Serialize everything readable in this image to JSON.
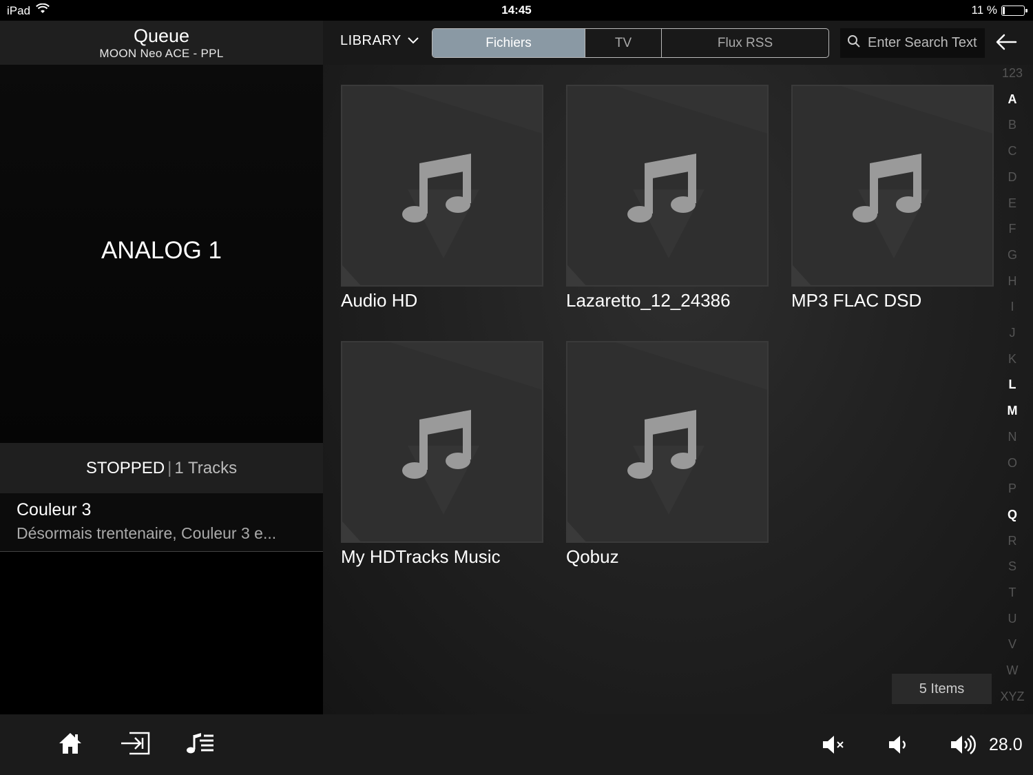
{
  "status_bar": {
    "device": "iPad",
    "time": "14:45",
    "battery": "11 %",
    "battery_level": 0.11
  },
  "queue": {
    "title": "Queue",
    "zone": "MOON Neo ACE - PPL",
    "now_playing_source": "ANALOG 1",
    "state": "STOPPED",
    "separator": "|",
    "track_count": "1 Tracks",
    "items": [
      {
        "title": "Couleur 3",
        "subtitle": "Désormais trentenaire, Couleur 3 e..."
      }
    ]
  },
  "library": {
    "dropdown_label": "LIBRARY",
    "tabs": [
      {
        "label": "Fichiers",
        "active": true
      },
      {
        "label": "TV",
        "active": false
      },
      {
        "label": "Flux RSS",
        "active": false
      }
    ],
    "search_placeholder": "Enter Search Text",
    "tiles": [
      {
        "label": "Audio HD"
      },
      {
        "label": "Lazaretto_12_24386"
      },
      {
        "label": "MP3 FLAC DSD"
      },
      {
        "label": "My HDTracks Music"
      },
      {
        "label": "Qobuz"
      }
    ],
    "items_count": "5 Items",
    "alpha_index": [
      {
        "label": "123",
        "active": false
      },
      {
        "label": "A",
        "active": true
      },
      {
        "label": "B",
        "active": false
      },
      {
        "label": "C",
        "active": false
      },
      {
        "label": "D",
        "active": false
      },
      {
        "label": "E",
        "active": false
      },
      {
        "label": "F",
        "active": false
      },
      {
        "label": "G",
        "active": false
      },
      {
        "label": "H",
        "active": false
      },
      {
        "label": "I",
        "active": false
      },
      {
        "label": "J",
        "active": false
      },
      {
        "label": "K",
        "active": false
      },
      {
        "label": "L",
        "active": true
      },
      {
        "label": "M",
        "active": true
      },
      {
        "label": "N",
        "active": false
      },
      {
        "label": "O",
        "active": false
      },
      {
        "label": "P",
        "active": false
      },
      {
        "label": "Q",
        "active": true
      },
      {
        "label": "R",
        "active": false
      },
      {
        "label": "S",
        "active": false
      },
      {
        "label": "T",
        "active": false
      },
      {
        "label": "U",
        "active": false
      },
      {
        "label": "V",
        "active": false
      },
      {
        "label": "W",
        "active": false
      },
      {
        "label": "XYZ",
        "active": false
      }
    ]
  },
  "bottom_bar": {
    "icons": [
      "home-icon",
      "input-select-icon",
      "playlist-icon",
      "mute-icon",
      "volume-down-icon",
      "volume-up-icon"
    ],
    "volume": "28.0"
  },
  "colors": {
    "active_tab": "#8a99a4",
    "panel_dark": "#1f1f1f"
  }
}
